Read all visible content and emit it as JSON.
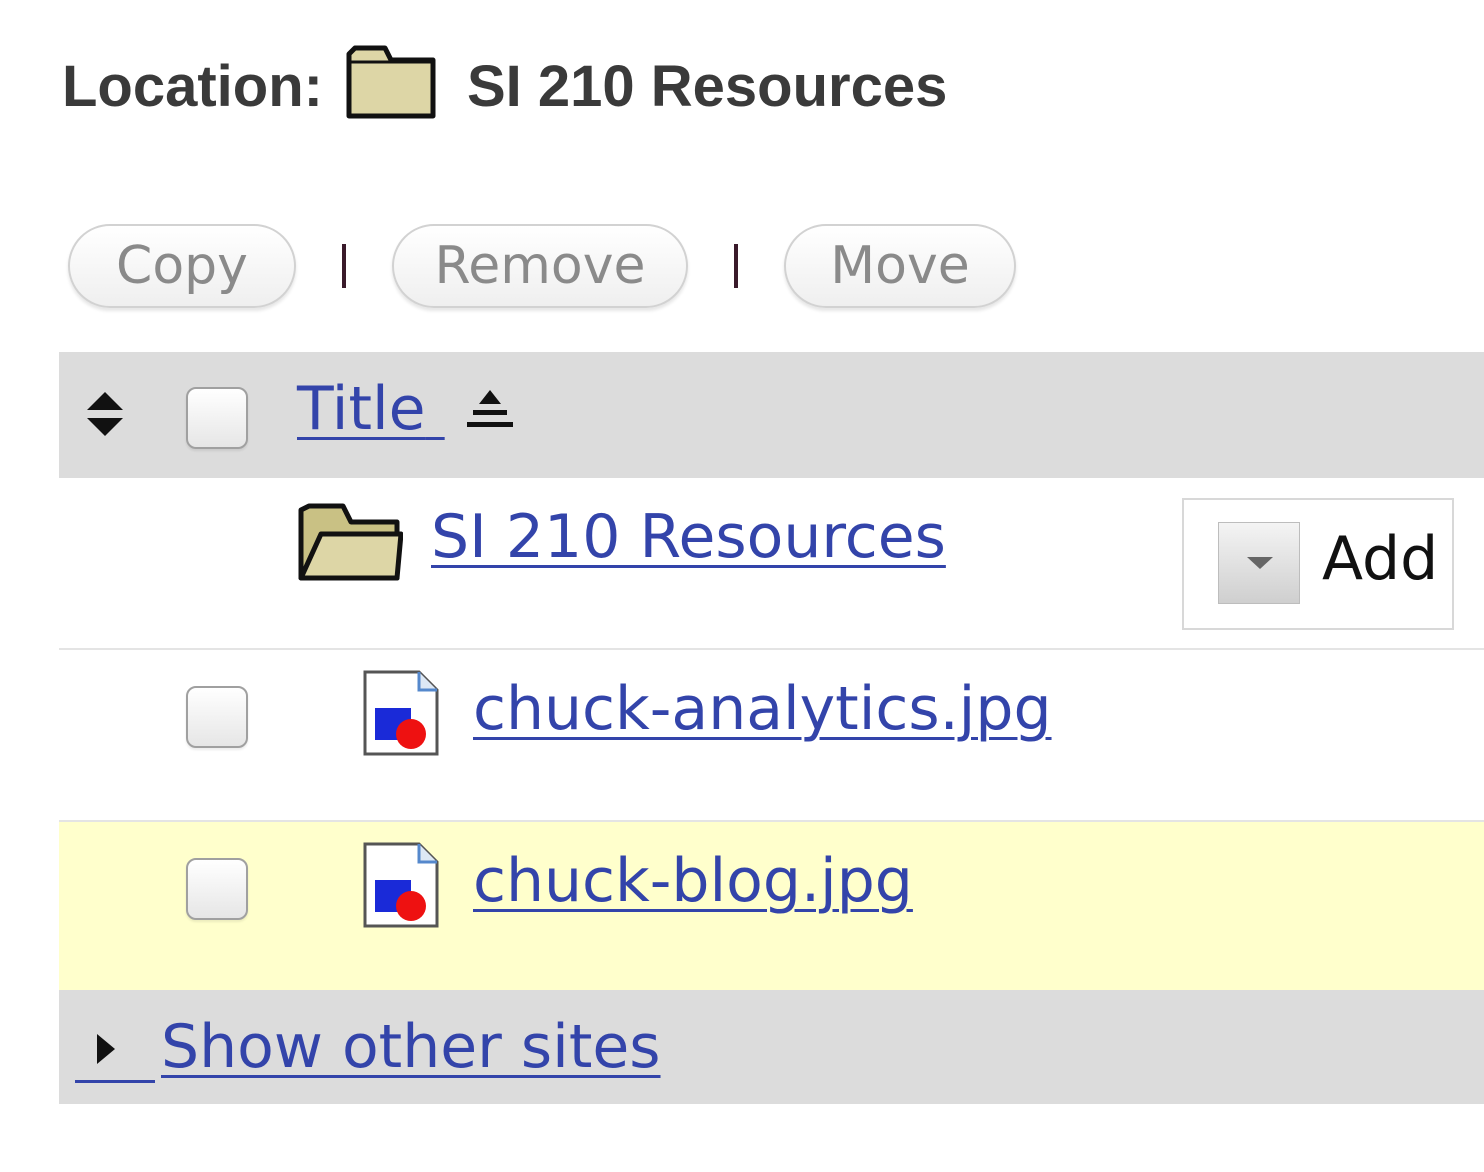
{
  "location": {
    "label": "Location:",
    "folder_icon": "folder-closed-icon",
    "folder_name": "SI 210 Resources"
  },
  "toolbar": {
    "copy_label": "Copy",
    "separator": "|",
    "remove_label": "Remove",
    "move_label": "Move"
  },
  "table": {
    "header": {
      "sort_icon": "sort-updown-icon",
      "title_label": "Title",
      "title_sort_icon": "sort-ascending-icon"
    },
    "folder_row": {
      "icon": "folder-open-icon",
      "name": "SI 210 Resources",
      "add_menu_label": "Add"
    },
    "files": [
      {
        "name": "chuck-analytics.jpg",
        "icon": "image-file-icon",
        "highlighted": false
      },
      {
        "name": "chuck-blog.jpg",
        "icon": "image-file-icon",
        "highlighted": true
      }
    ],
    "footer": {
      "expand_icon": "triangle-right-icon",
      "show_other_sites_label": "Show other sites"
    }
  },
  "colors": {
    "link": "#3344aa",
    "header_bg": "#dcdcdc",
    "highlight_row_bg": "#ffffcc",
    "folder_fill": "#ddd6a6"
  }
}
